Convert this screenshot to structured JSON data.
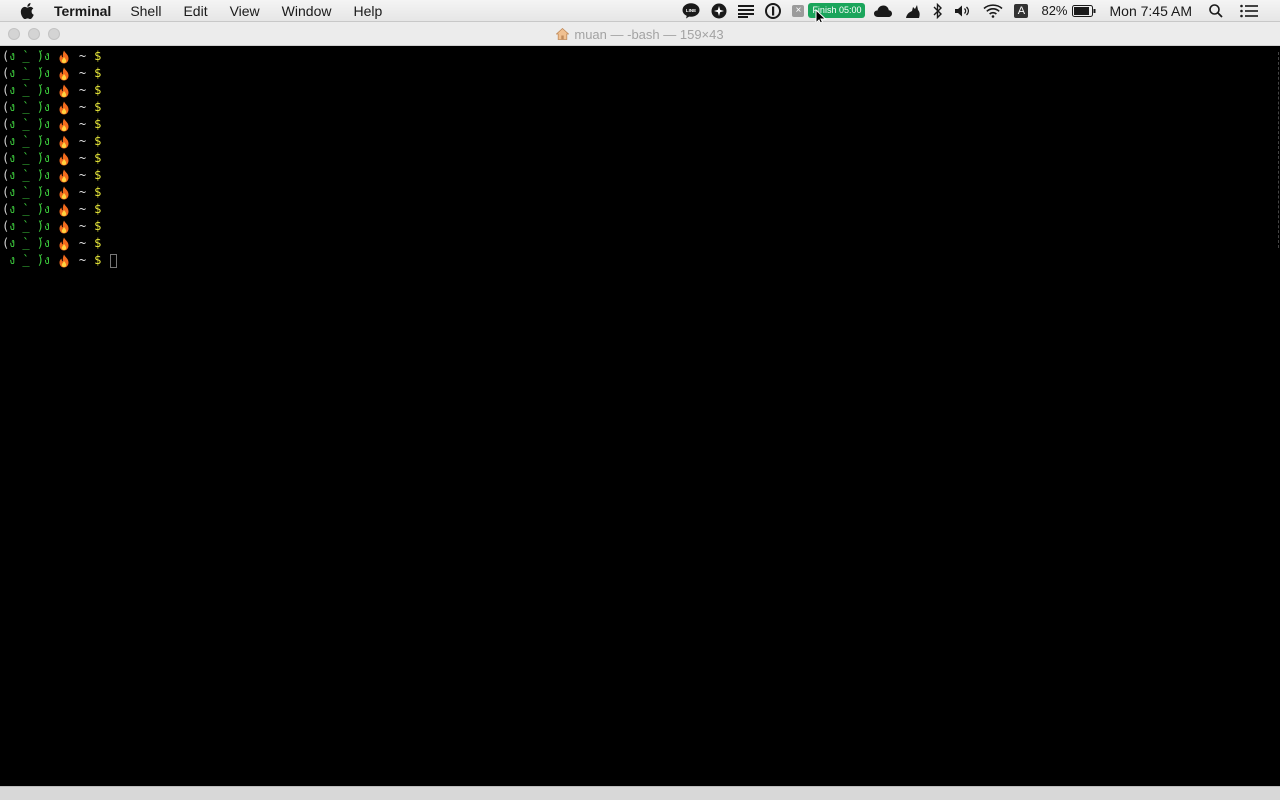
{
  "menubar": {
    "app_name": "Terminal",
    "menus": [
      "Shell",
      "Edit",
      "View",
      "Window",
      "Help"
    ],
    "tray": {
      "line_label": "LINE",
      "timer_badge": "Finish 05:00",
      "input_source": "A",
      "battery_percent": "82%",
      "clock": "Mon 7:45 AM"
    }
  },
  "window": {
    "title": "muan — -bash — 159×43"
  },
  "terminal": {
    "prompt": {
      "open": "(",
      "face": "ง ̀_ ́)ง",
      "tilde": "~",
      "dollar": "$"
    },
    "line_count": 13
  },
  "colors": {
    "face": "#3ecf3e",
    "dollar": "#e8e83a",
    "timer_badge": "#1aa55b",
    "terminal_bg": "#000000"
  }
}
